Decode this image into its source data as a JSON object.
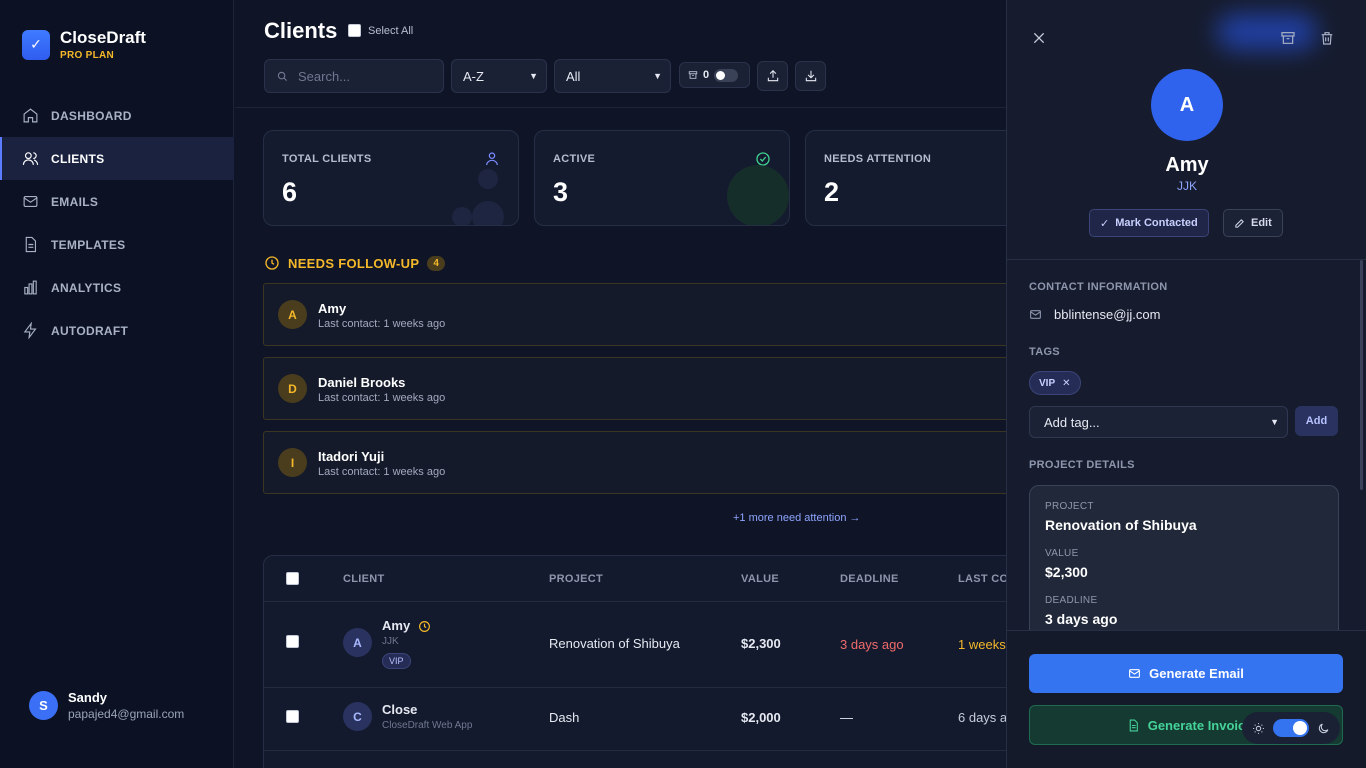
{
  "brand": {
    "name": "CloseDraft",
    "plan": "PRO PLAN"
  },
  "nav": [
    {
      "label": "DASHBOARD",
      "icon": "home-icon"
    },
    {
      "label": "CLIENTS",
      "icon": "users-icon",
      "active": true
    },
    {
      "label": "EMAILS",
      "icon": "mail-icon"
    },
    {
      "label": "TEMPLATES",
      "icon": "file-icon"
    },
    {
      "label": "ANALYTICS",
      "icon": "bar-chart-icon"
    },
    {
      "label": "AUTODRAFT",
      "icon": "bolt-icon"
    }
  ],
  "user": {
    "initial": "S",
    "name": "Sandy",
    "email": "papajed4@gmail.com"
  },
  "header": {
    "title": "Clients",
    "select_all": "Select All",
    "search_placeholder": "Search...",
    "sort": "A-Z",
    "filter": "All",
    "archived_count": "0"
  },
  "stats": [
    {
      "label": "TOTAL CLIENTS",
      "value": "6"
    },
    {
      "label": "ACTIVE",
      "value": "3"
    },
    {
      "label": "NEEDS ATTENTION",
      "value": "2"
    }
  ],
  "followup": {
    "title": "NEEDS FOLLOW-UP",
    "count": "4",
    "items": [
      {
        "initial": "A",
        "name": "Amy",
        "sub": "Last contact: 1 weeks ago"
      },
      {
        "initial": "D",
        "name": "Daniel Brooks",
        "sub": "Last contact: 1 weeks ago"
      },
      {
        "initial": "I",
        "name": "Itadori Yuji",
        "sub": "Last contact: 1 weeks ago"
      }
    ],
    "more": "+1 more need attention →"
  },
  "table": {
    "headers": [
      "CLIENT",
      "PROJECT",
      "VALUE",
      "DEADLINE",
      "LAST CO"
    ],
    "rows": [
      {
        "initial": "A",
        "name": "Amy",
        "company": "JJK",
        "tag": "VIP",
        "project": "Renovation of Shibuya",
        "value": "$2,300",
        "deadline": "3 days ago",
        "last": "1 weeks"
      },
      {
        "initial": "C",
        "name": "Close",
        "company": "CloseDraft Web App",
        "project": "Dash",
        "value": "$2,000",
        "deadline": "—",
        "last": "6 days a"
      }
    ]
  },
  "panel": {
    "initial": "A",
    "name": "Amy",
    "company": "JJK",
    "mark_contacted": "Mark Contacted",
    "edit": "Edit",
    "contact_label": "CONTACT INFORMATION",
    "email": "bblintense@jj.com",
    "tags_label": "TAGS",
    "tag": "VIP",
    "add_tag_placeholder": "Add tag...",
    "add": "Add",
    "project_label": "PROJECT DETAILS",
    "project_title_label": "PROJECT",
    "project": "Renovation of Shibuya",
    "value_label": "VALUE",
    "value": "$2,300",
    "deadline_label": "DEADLINE",
    "deadline": "3 days ago",
    "generate_email": "Generate Email",
    "generate_invoice": "Generate Invoic"
  },
  "colors": {
    "accent": "#3474f1",
    "warning": "#f5b82a",
    "success": "#45d39a",
    "danger": "#f06b6b"
  }
}
